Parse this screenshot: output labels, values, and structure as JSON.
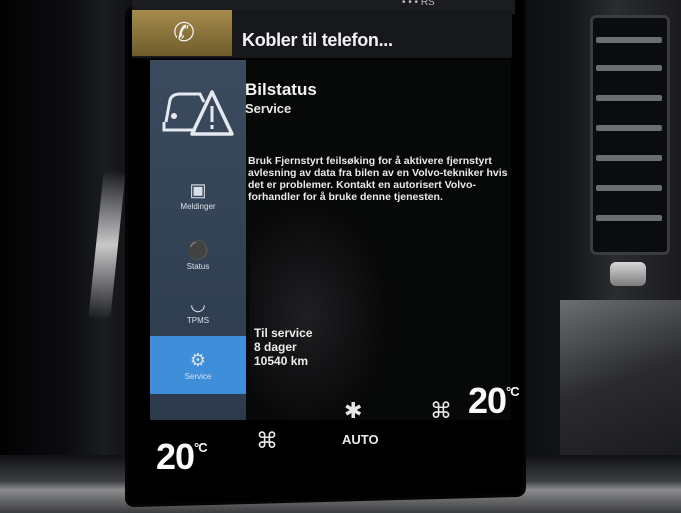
{
  "top_bar": {
    "text": "• • • RS"
  },
  "call_bar": {
    "label": "Kobler til telefon...",
    "icon": "phone-icon"
  },
  "sidebar": {
    "items": [
      {
        "label": "Meldinger",
        "icon": "message-truck-icon"
      },
      {
        "label": "Status",
        "icon": "car-key-icon"
      },
      {
        "label": "TPMS",
        "icon": "tire-icon"
      },
      {
        "label": "Service",
        "icon": "wrench-car-icon"
      }
    ],
    "active": "Service"
  },
  "content": {
    "title": "Bilstatus",
    "subtitle": "Service",
    "body": "Bruk Fjernstyrt feilsøking for å aktivere fjernstyrt avlesning av data fra bilen av en Volvo-tekniker hvis det er problemer. Kontakt en autorisert Volvo-forhandler for å bruke denne tjenesten.",
    "service": {
      "label": "Til service",
      "days": "8 dager",
      "distance": "10540 km"
    }
  },
  "climate": {
    "left_temp": "20",
    "right_temp": "20",
    "unit": "°C",
    "auto_label": "AUTO"
  },
  "colors": {
    "accent_active": "#3f8ed9",
    "sidebar_bg": "#3b4a5e",
    "phone_tile": "#a58b4c"
  }
}
